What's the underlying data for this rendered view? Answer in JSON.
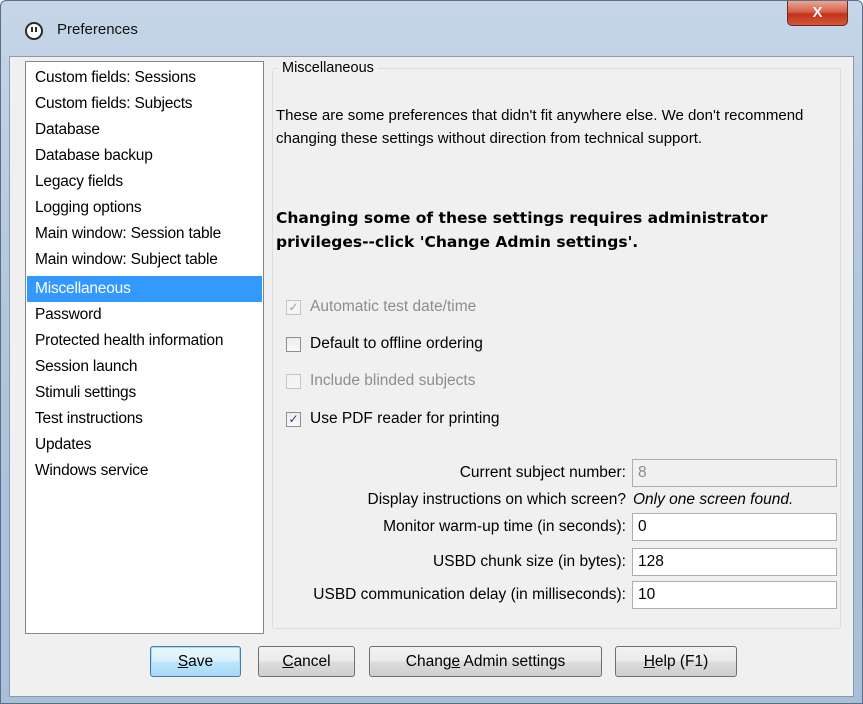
{
  "window": {
    "title": "Preferences",
    "close_label": "X"
  },
  "sidebar": {
    "items": [
      {
        "label": "Custom fields: Sessions",
        "selected": false
      },
      {
        "label": "Custom fields: Subjects",
        "selected": false
      },
      {
        "label": "Database",
        "selected": false
      },
      {
        "label": "Database backup",
        "selected": false
      },
      {
        "label": "Legacy fields",
        "selected": false
      },
      {
        "label": "Logging options",
        "selected": false
      },
      {
        "label": "Main window: Session table",
        "selected": false
      },
      {
        "label": "Main window: Subject table",
        "selected": false
      },
      {
        "label": "Miscellaneous",
        "selected": true
      },
      {
        "label": "Password",
        "selected": false
      },
      {
        "label": "Protected health information",
        "selected": false
      },
      {
        "label": "Session launch",
        "selected": false
      },
      {
        "label": "Stimuli settings",
        "selected": false
      },
      {
        "label": "Test instructions",
        "selected": false
      },
      {
        "label": "Updates",
        "selected": false
      },
      {
        "label": "Windows service",
        "selected": false
      }
    ]
  },
  "panel": {
    "group_title": "Miscellaneous",
    "description": "These are some preferences that didn't fit anywhere else. We don't recommend changing these settings without direction from technical support.",
    "warning": "Changing some of these settings requires administrator privileges--click 'Change Admin settings'.",
    "checkboxes": [
      {
        "label": "Automatic test date/time",
        "checked": true,
        "enabled": false
      },
      {
        "label": "Default to offline ordering",
        "checked": false,
        "enabled": true
      },
      {
        "label": "Include blinded subjects",
        "checked": false,
        "enabled": false
      },
      {
        "label": "Use PDF reader for printing",
        "checked": true,
        "enabled": true
      }
    ],
    "fields": {
      "current_subject_label": "Current subject number:",
      "current_subject_value": "8",
      "display_screen_label": "Display instructions on which screen?",
      "display_screen_note": "Only one screen found.",
      "warmup_label": "Monitor warm-up time (in seconds):",
      "warmup_value": "0",
      "chunk_label": "USBD chunk size (in bytes):",
      "chunk_value": "128",
      "delay_label": "USBD communication delay (in milliseconds):",
      "delay_value": "10"
    }
  },
  "buttons": {
    "save": {
      "mnemonic": "S",
      "rest": "ave"
    },
    "cancel": {
      "mnemonic": "C",
      "rest": "ancel"
    },
    "admin": {
      "pre": "Chang",
      "mnemonic": "e",
      "rest": " Admin settings"
    },
    "help": {
      "mnemonic": "H",
      "rest": "elp (F1)"
    }
  },
  "check_glyph": "✓"
}
